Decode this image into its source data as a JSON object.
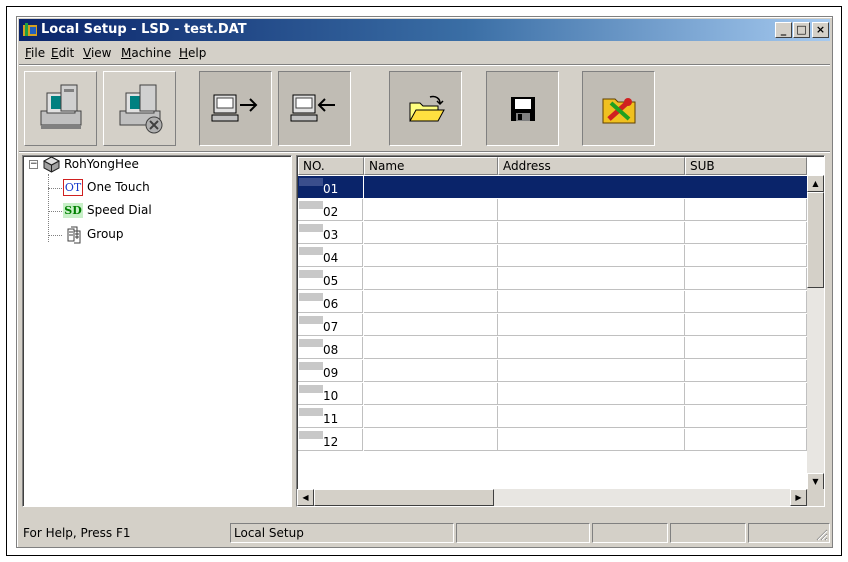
{
  "window": {
    "title": "Local Setup - LSD - test.DAT",
    "controls": {
      "minimize": "_",
      "maximize": "□",
      "close": "×"
    }
  },
  "menu": [
    {
      "label": "File",
      "mnemonic": "F"
    },
    {
      "label": "Edit",
      "mnemonic": "E"
    },
    {
      "label": "View",
      "mnemonic": "V"
    },
    {
      "label": "Machine",
      "mnemonic": "M"
    },
    {
      "label": "Help",
      "mnemonic": "H"
    }
  ],
  "toolbar": [
    {
      "icon": "computer-icon"
    },
    {
      "icon": "computer-disconnect-icon"
    },
    {
      "icon": "send-to-machine-icon"
    },
    {
      "icon": "receive-from-machine-icon"
    },
    {
      "icon": "open-folder-icon"
    },
    {
      "icon": "save-disk-icon"
    },
    {
      "icon": "tools-settings-icon"
    }
  ],
  "tree": {
    "root": {
      "label": "RohYongHee",
      "expander": "−"
    },
    "children": [
      {
        "label": "One Touch",
        "badge": "OT",
        "badge_color": "#1a3ccc"
      },
      {
        "label": "Speed Dial",
        "badge": "SD",
        "badge_color": "#008000"
      },
      {
        "label": "Group"
      }
    ]
  },
  "grid": {
    "columns": [
      "NO.",
      "Name",
      "Address",
      "SUB"
    ],
    "rows": [
      "01",
      "02",
      "03",
      "04",
      "05",
      "06",
      "07",
      "08",
      "09",
      "10",
      "11",
      "12"
    ],
    "selected_row": "01",
    "selection_color": "#0a246a"
  },
  "status": {
    "help": "For Help, Press F1",
    "mode": "Local Setup"
  }
}
